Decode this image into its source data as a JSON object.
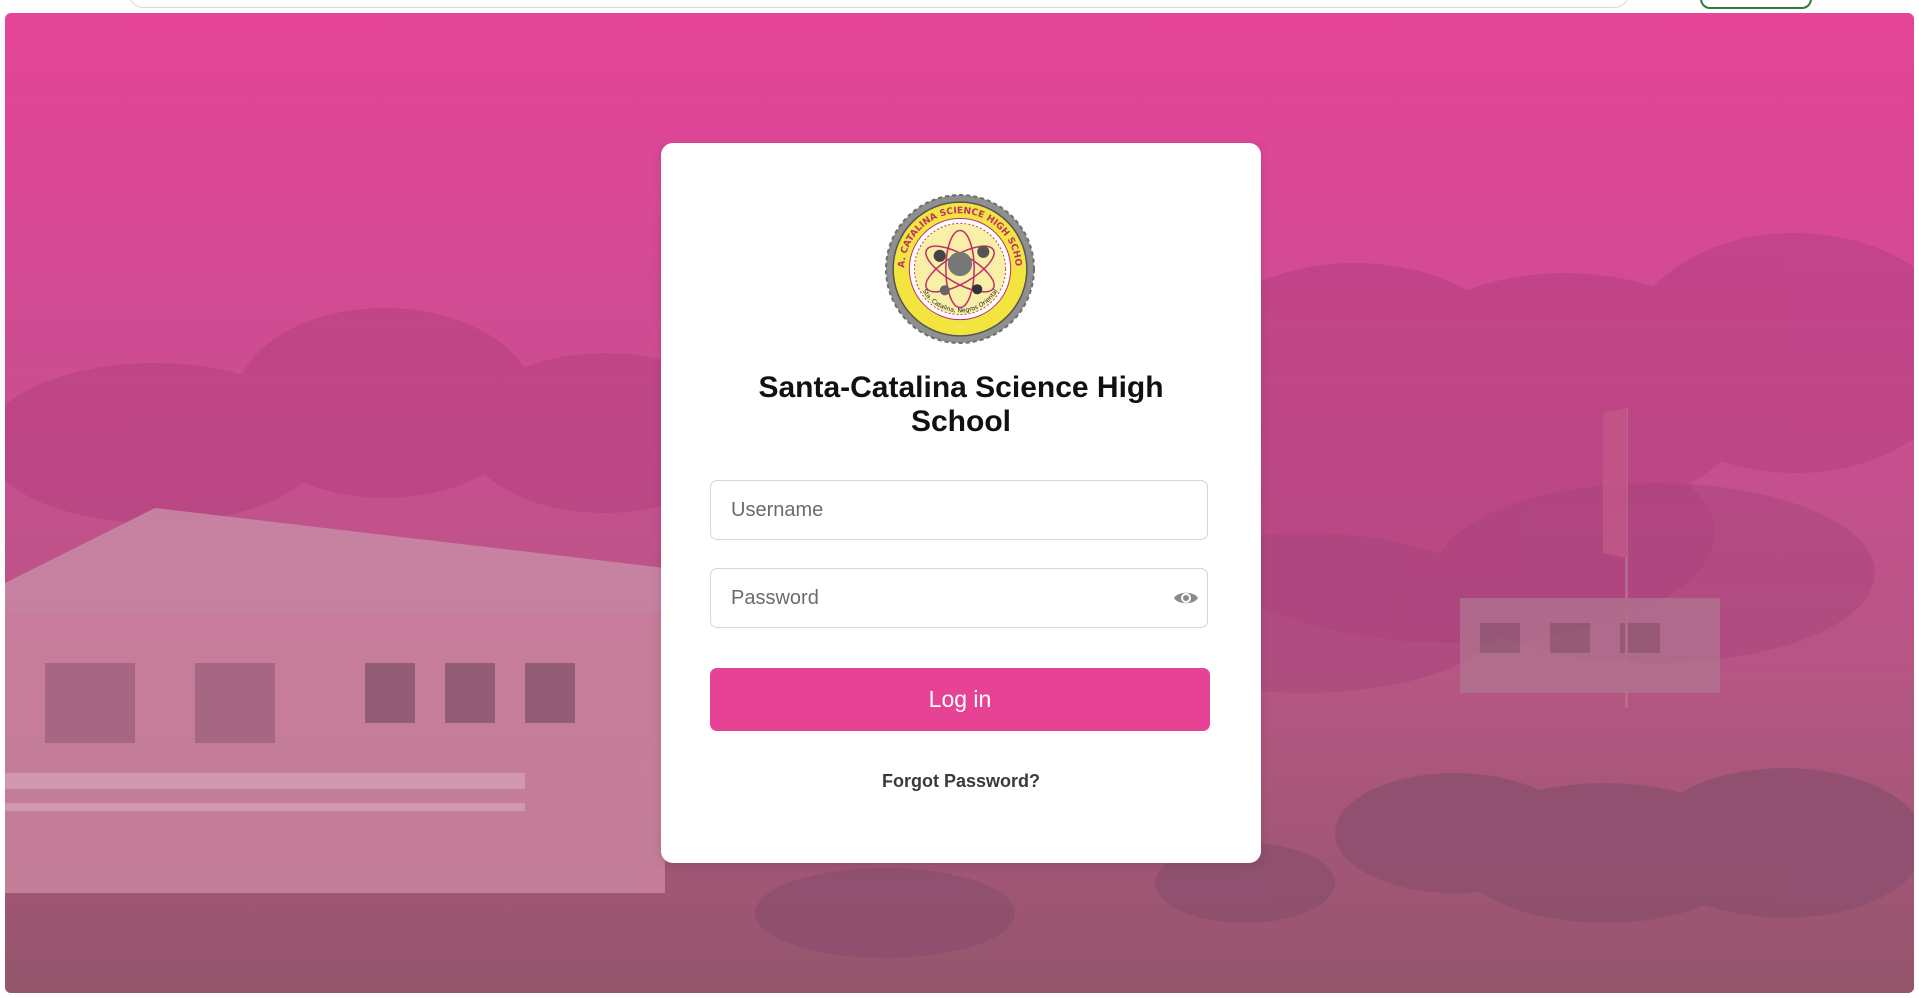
{
  "colors": {
    "brand_pink": "#e74394",
    "background_top": "#e54597",
    "background_bottom": "#a15673",
    "card_background": "#ffffff"
  },
  "logo": {
    "ring_text_top": "STA. CATALINA SCIENCE HIGH SCHOOL",
    "ring_text_bottom": "Sta. Catalina, Negros Oriental"
  },
  "login": {
    "title": "Santa-Catalina Science High School",
    "username_placeholder": "Username",
    "password_placeholder": "Password",
    "show_password_icon": "eye-icon",
    "login_label": "Log in",
    "forgot_label": "Forgot Password?"
  }
}
